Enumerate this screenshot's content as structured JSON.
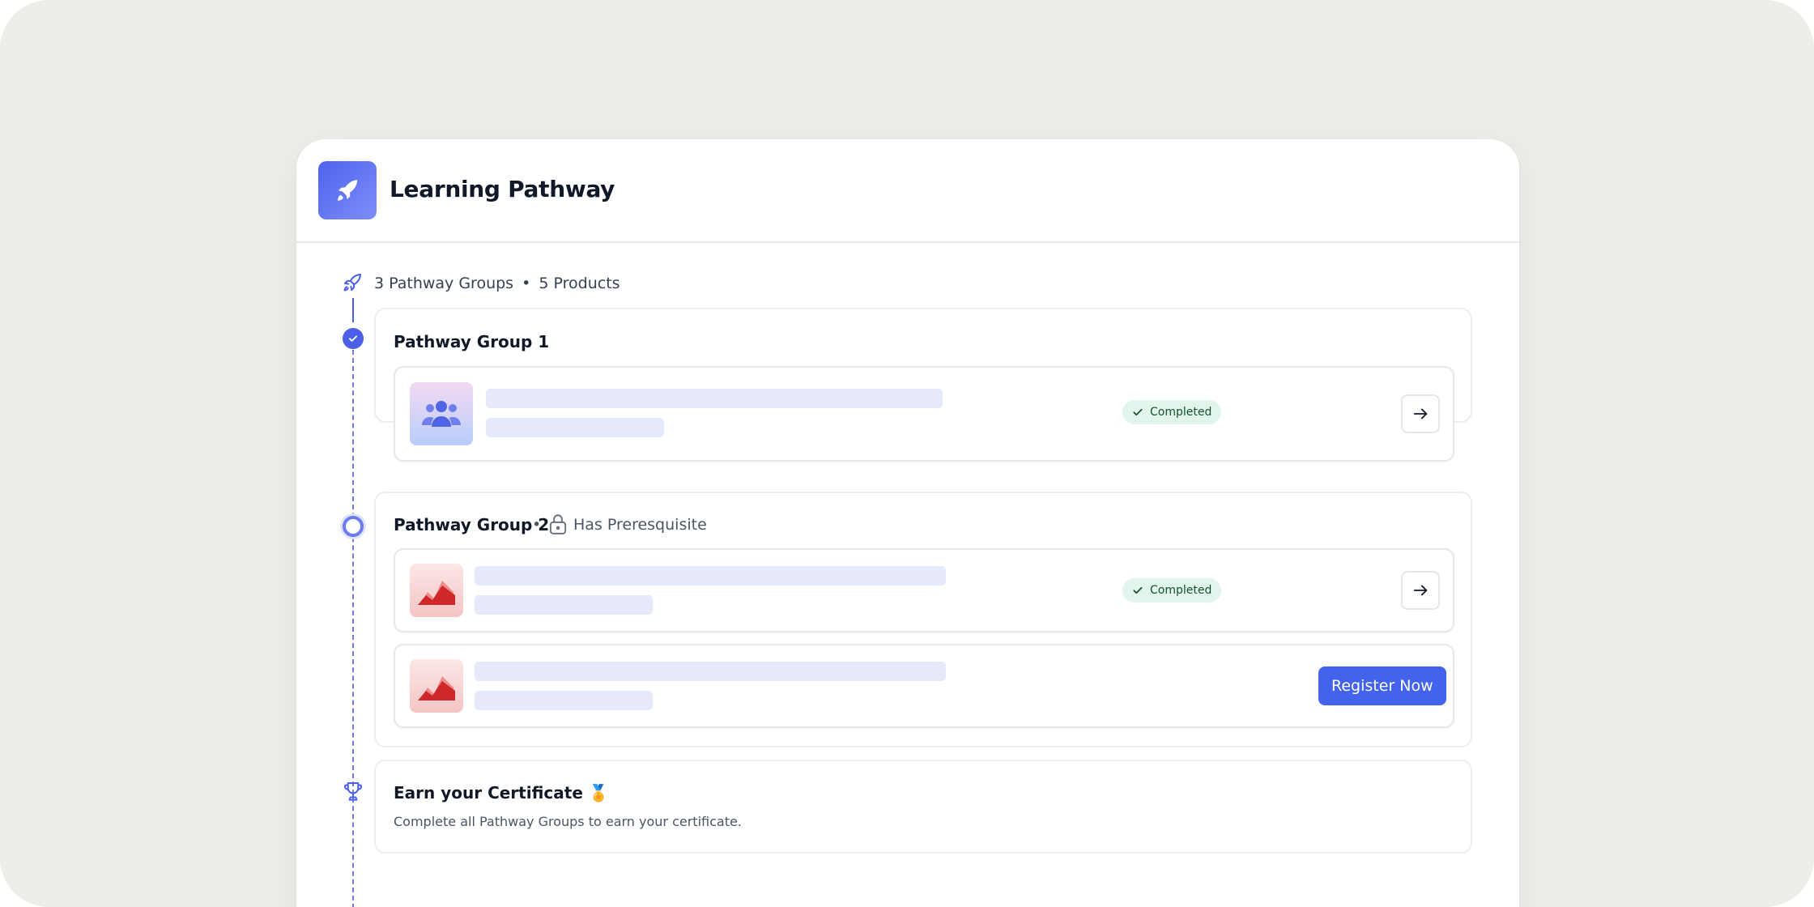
{
  "header": {
    "title": "Learning Pathway",
    "logo_icon": "rocket-icon"
  },
  "summary": {
    "groups_label": "3 Pathway Groups",
    "separator": "•",
    "products_label": "5 Products"
  },
  "groups": [
    {
      "title": "Pathway Group 1",
      "status": "completed",
      "items": [
        {
          "thumb": "people-icon",
          "status_label": "Completed",
          "action": "arrow"
        }
      ]
    },
    {
      "title": "Pathway Group 2",
      "separator": "•",
      "prerequisite_label": "Has Preresquisite",
      "status": "in-progress",
      "items": [
        {
          "thumb": "area-chart-icon",
          "status_label": "Completed",
          "action": "arrow"
        },
        {
          "thumb": "area-chart-icon",
          "action_label": "Register Now"
        }
      ]
    }
  ],
  "certificate": {
    "title": "Earn your Certificate",
    "emoji": "🏅",
    "description": "Complete all Pathway Groups to earn your certificate."
  },
  "colors": {
    "accent": "#4463ec",
    "completed_bg": "#e2f5ec",
    "skeleton": "#e6e9fb"
  }
}
